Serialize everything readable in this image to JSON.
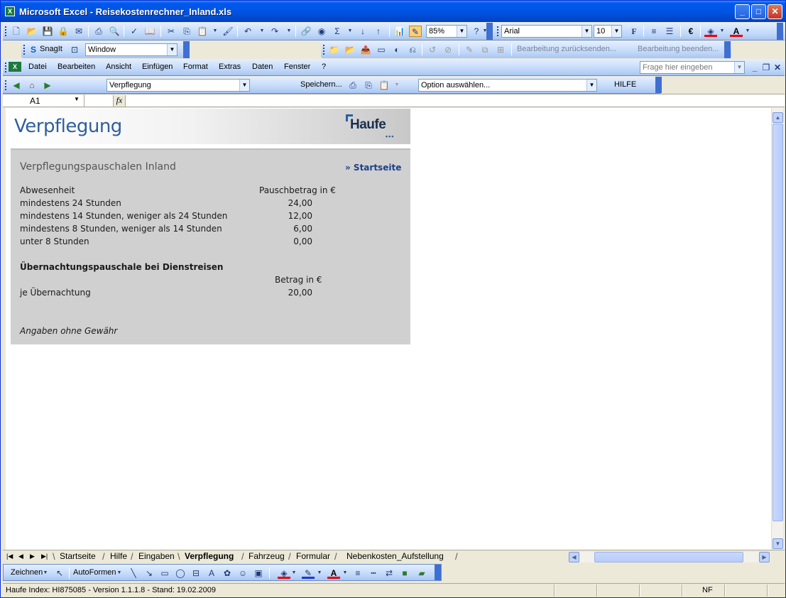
{
  "window": {
    "title": "Microsoft Excel - Reisekostenrechner_Inland.xls",
    "minimize": "_",
    "maximize": "□",
    "close": "✕"
  },
  "standard_toolbar": {
    "zoom": "85%",
    "font": "Arial",
    "font_size": "10",
    "bold_label": "F"
  },
  "snagit_toolbar": {
    "snagit_label": "SnagIt",
    "capture_mode": "Window",
    "review_reply": "Bearbeitung zurücksenden...",
    "review_end": "Bearbeitung beenden..."
  },
  "menu": {
    "items": [
      "Datei",
      "Bearbeiten",
      "Ansicht",
      "Einfügen",
      "Format",
      "Extras",
      "Daten",
      "Fenster",
      "?"
    ],
    "help_placeholder": "Frage hier eingeben"
  },
  "custom_toolbar": {
    "sheet_select": "Verpflegung",
    "save_label": "Speichern...",
    "option_select": "Option auswählen...",
    "help_label": "HILFE"
  },
  "formula_bar": {
    "cell_ref": "A1",
    "fx": "fx",
    "content": ""
  },
  "sheet": {
    "header_title": "Verpflegung",
    "logo_text": "Haufe",
    "logo_dots": "•••",
    "section_title": "Verpflegungspauschalen Inland",
    "start_link": "» Startseite",
    "col_absence": "Abwesenheit",
    "col_amount": "Pauschbetrag in €",
    "rows": [
      {
        "label": "mindestens 24 Stunden",
        "value": "24,00"
      },
      {
        "label": "mindestens 14 Stunden, weniger als 24 Stunden",
        "value": "12,00"
      },
      {
        "label": "mindestens 8 Stunden, weniger als 14 Stunden",
        "value": "6,00"
      },
      {
        "label": "unter 8 Stunden",
        "value": "0,00"
      }
    ],
    "overnight_title": "Übernachtungspauschale bei Dienstreisen",
    "overnight_col": "Betrag in €",
    "overnight_label": "je Übernachtung",
    "overnight_value": "20,00",
    "disclaimer": "Angaben ohne Gewähr"
  },
  "tabs": {
    "items": [
      "Startseite",
      "Hilfe",
      "Eingaben",
      "Verpflegung",
      "Fahrzeug",
      "Formular",
      "Nebenkosten_Aufstellung"
    ],
    "active": "Verpflegung"
  },
  "drawing_toolbar": {
    "draw_label": "Zeichnen",
    "autoshapes_label": "AutoFormen"
  },
  "status": {
    "text": "Haufe Index: HI875085 - Version 1.1.1.8 - Stand: 19.02.2009",
    "mode": "NF"
  },
  "colors": {
    "title_bar": "#0054E3",
    "header_title": "#2E5F9E",
    "panel": "#D0D0D0",
    "link": "#1B3F8C"
  }
}
